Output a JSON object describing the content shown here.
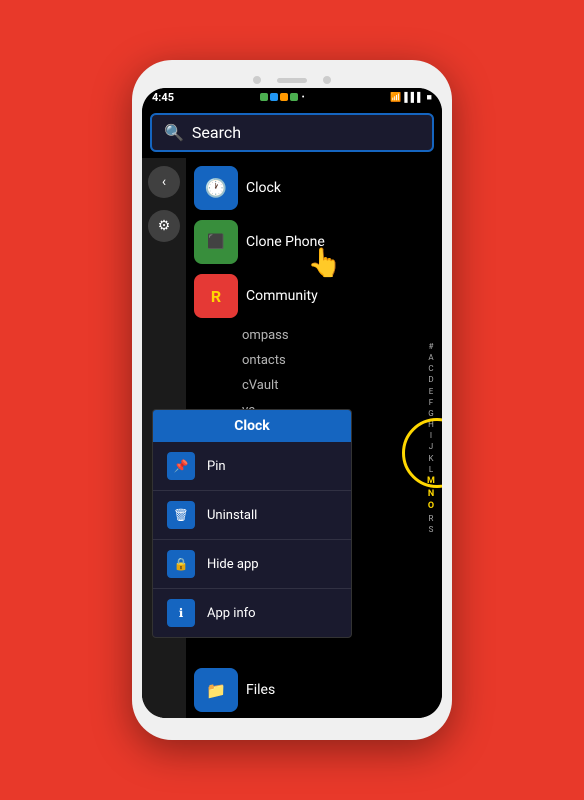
{
  "phone": {
    "status_bar": {
      "time": "4:45",
      "icons_label": "status icons",
      "battery": "■"
    },
    "search": {
      "placeholder": "Search",
      "value": "Search"
    },
    "apps": [
      {
        "id": "clock",
        "name": "Clock",
        "icon_color": "#1565C0",
        "icon_char": "🕐"
      },
      {
        "id": "clone-phone",
        "name": "Clone Phone",
        "icon_color": "#388E3C",
        "icon_char": "📋"
      },
      {
        "id": "community",
        "name": "Community",
        "icon_color": "#e53935",
        "icon_char": "R"
      }
    ],
    "partial_apps": [
      {
        "name": "ompass"
      },
      {
        "name": "ontacts"
      },
      {
        "name": "cVault"
      },
      {
        "name": "ve"
      }
    ],
    "files_app": {
      "name": "Files",
      "icon_color": "#1565C0",
      "icon_char": "📁"
    },
    "alphabet": [
      "#",
      "A",
      "C",
      "D",
      "E",
      "F",
      "G",
      "H",
      "I",
      "J",
      "K",
      "L",
      "M",
      "N",
      "O",
      "R",
      "S"
    ],
    "highlighted_letters": [
      "M",
      "N",
      "O"
    ]
  },
  "context_menu": {
    "title": "Clock",
    "items": [
      {
        "id": "pin",
        "label": "Pin",
        "icon": "📌"
      },
      {
        "id": "uninstall",
        "label": "Uninstall",
        "icon": "🗑"
      },
      {
        "id": "hide-app",
        "label": "Hide app",
        "icon": "🔒"
      },
      {
        "id": "app-info",
        "label": "App info",
        "icon": "ℹ"
      }
    ]
  },
  "icons": {
    "search": "🔍",
    "back": "‹",
    "settings": "⚙",
    "cursor": "👆"
  }
}
